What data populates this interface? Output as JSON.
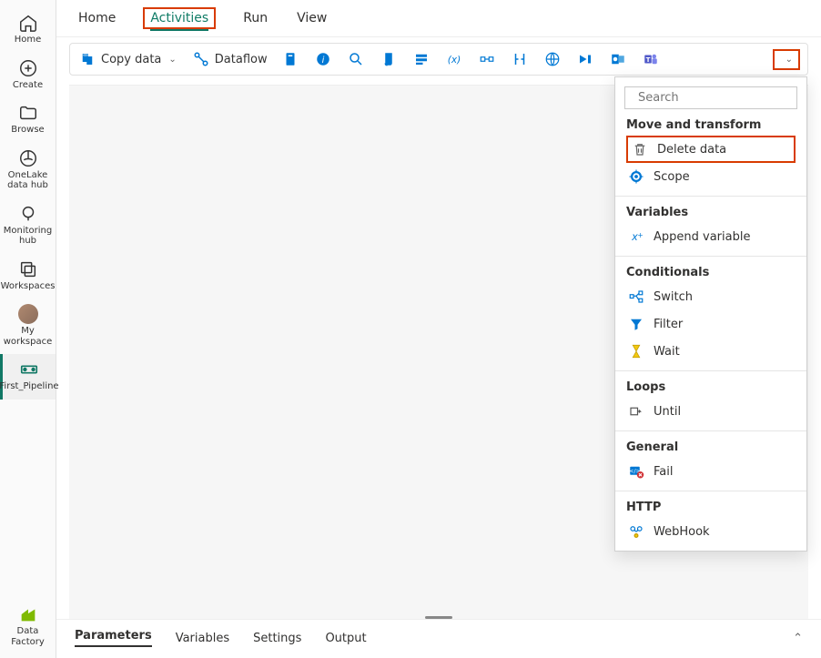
{
  "rail": {
    "items": [
      {
        "id": "home",
        "label": "Home"
      },
      {
        "id": "create",
        "label": "Create"
      },
      {
        "id": "browse",
        "label": "Browse"
      },
      {
        "id": "onelake",
        "label": "OneLake data hub"
      },
      {
        "id": "monitoring",
        "label": "Monitoring hub"
      },
      {
        "id": "workspaces",
        "label": "Workspaces"
      },
      {
        "id": "myworkspace",
        "label": "My workspace"
      },
      {
        "id": "firstpipeline",
        "label": "First_Pipeline"
      }
    ],
    "footer": {
      "label": "Data Factory"
    }
  },
  "tabs": [
    "Home",
    "Activities",
    "Run",
    "View"
  ],
  "active_tab": "Activities",
  "toolbar": {
    "copy_label": "Copy data",
    "dataflow_label": "Dataflow"
  },
  "panel": {
    "search_placeholder": "Search",
    "groups": [
      {
        "title": "Move and transform",
        "items": [
          {
            "id": "delete-data",
            "label": "Delete data",
            "highlight": true
          },
          {
            "id": "scope",
            "label": "Scope"
          }
        ]
      },
      {
        "title": "Variables",
        "items": [
          {
            "id": "append-variable",
            "label": "Append variable"
          }
        ]
      },
      {
        "title": "Conditionals",
        "items": [
          {
            "id": "switch",
            "label": "Switch"
          },
          {
            "id": "filter",
            "label": "Filter"
          },
          {
            "id": "wait",
            "label": "Wait"
          }
        ]
      },
      {
        "title": "Loops",
        "items": [
          {
            "id": "until",
            "label": "Until"
          }
        ]
      },
      {
        "title": "General",
        "items": [
          {
            "id": "fail",
            "label": "Fail"
          }
        ]
      },
      {
        "title": "HTTP",
        "items": [
          {
            "id": "webhook",
            "label": "WebHook"
          }
        ]
      }
    ]
  },
  "bottom_tabs": [
    "Parameters",
    "Variables",
    "Settings",
    "Output"
  ],
  "bottom_active": "Parameters"
}
